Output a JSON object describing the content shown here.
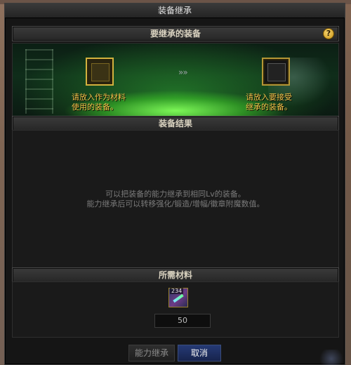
{
  "window": {
    "title": "装备继承"
  },
  "sections": {
    "inherit_header": "要继承的装备",
    "result_header": "装备结果",
    "material_header": "所需材料"
  },
  "help_icon_label": "?",
  "arrows": "»»",
  "slots": {
    "left_caption_line1": "请放入作为材料",
    "left_caption_line2": "使用的装备。",
    "right_caption_line1": "请放入要接受",
    "right_caption_line2": "继承的装备。"
  },
  "result": {
    "line1": "可以把装备的能力继承到相同Lv的装备。",
    "line2": "能力继承后可以转移强化/锻造/增幅/徽章附魔数值。"
  },
  "material": {
    "count": "234",
    "required_qty": "50"
  },
  "buttons": {
    "inherit": "能力继承",
    "cancel": "取消"
  },
  "colors": {
    "caption_gold": "#f3c24a",
    "button_blue": "#253a75",
    "panel_dark": "#151515"
  }
}
